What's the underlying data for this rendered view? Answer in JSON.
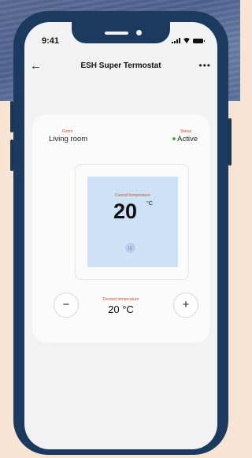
{
  "status_bar": {
    "time": "9:41"
  },
  "header": {
    "title": "ESH Super Termostat",
    "back_icon": "←",
    "more_icon": "•••"
  },
  "info": {
    "room_label": "Room",
    "room_value": "Living room",
    "status_label": "Status",
    "status_value": "Active",
    "status_color": "#39b54a"
  },
  "thermostat": {
    "current_label": "Current temperature",
    "current_value": "20",
    "current_unit": "°C",
    "heating_icon": "heating-icon"
  },
  "controls": {
    "minus_label": "−",
    "plus_label": "+",
    "desired_label": "Desired temperature",
    "desired_value": "20 °C"
  },
  "colors": {
    "accent": "#c4552f",
    "phone_frame": "#1b3a5e",
    "display_bg": "#cde1f7"
  }
}
